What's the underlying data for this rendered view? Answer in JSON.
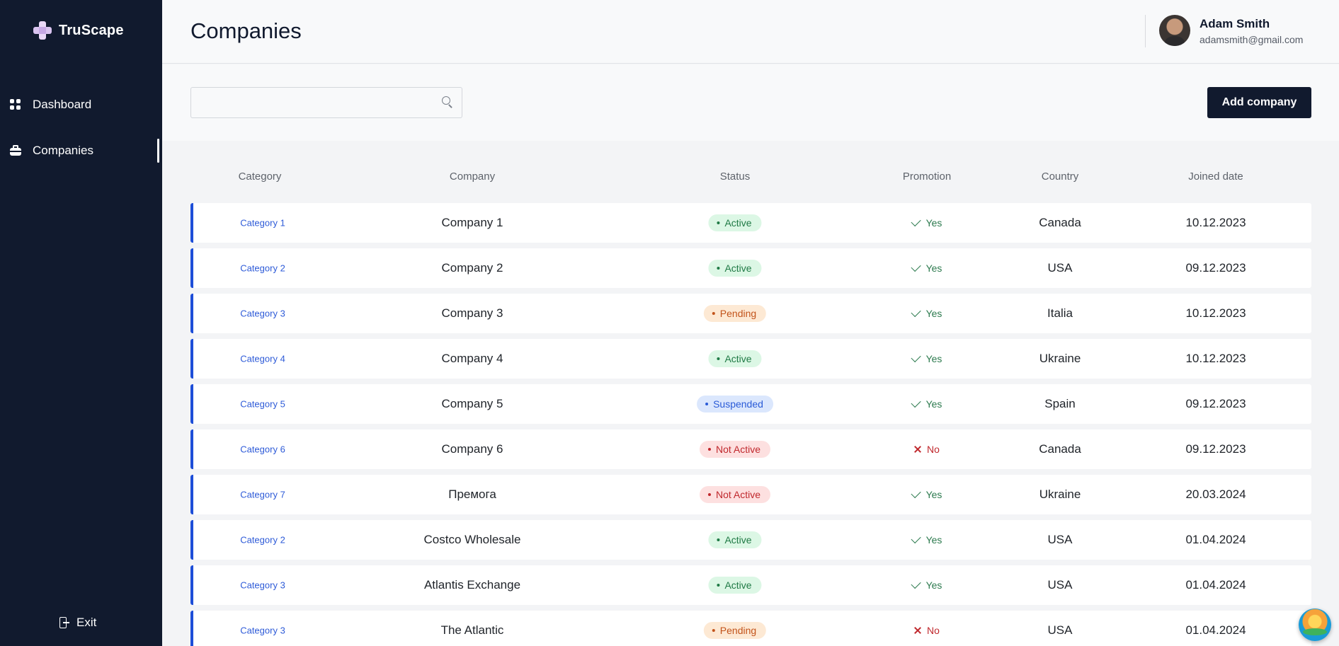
{
  "app": {
    "name": "TruScape"
  },
  "sidebar": {
    "items": [
      {
        "label": "Dashboard",
        "icon": "grid-icon",
        "active": false
      },
      {
        "label": "Companies",
        "icon": "briefcase-icon",
        "active": true
      }
    ],
    "exit_label": "Exit"
  },
  "header": {
    "title": "Companies",
    "user": {
      "name": "Adam Smith",
      "email": "adamsmith@gmail.com"
    }
  },
  "toolbar": {
    "search_value": "",
    "search_placeholder": "",
    "add_button": "Add company"
  },
  "table": {
    "columns": [
      "Category",
      "Company",
      "Status",
      "Promotion",
      "Country",
      "Joined date"
    ],
    "rows": [
      {
        "category": "Category 1",
        "company": "Company 1",
        "status": "Active",
        "status_type": "active",
        "promotion": "Yes",
        "country": "Canada",
        "joined": "10.12.2023"
      },
      {
        "category": "Category 2",
        "company": "Company 2",
        "status": "Active",
        "status_type": "active",
        "promotion": "Yes",
        "country": "USA",
        "joined": "09.12.2023"
      },
      {
        "category": "Category 3",
        "company": "Company 3",
        "status": "Pending",
        "status_type": "pending",
        "promotion": "Yes",
        "country": "Italia",
        "joined": "10.12.2023"
      },
      {
        "category": "Category 4",
        "company": "Company 4",
        "status": "Active",
        "status_type": "active",
        "promotion": "Yes",
        "country": "Ukraine",
        "joined": "10.12.2023"
      },
      {
        "category": "Category 5",
        "company": "Company 5",
        "status": "Suspended",
        "status_type": "suspended",
        "promotion": "Yes",
        "country": "Spain",
        "joined": "09.12.2023"
      },
      {
        "category": "Category 6",
        "company": "Company 6",
        "status": "Not Active",
        "status_type": "notactive",
        "promotion": "No",
        "country": "Canada",
        "joined": "09.12.2023"
      },
      {
        "category": "Category 7",
        "company": "Премога",
        "status": "Not Active",
        "status_type": "notactive",
        "promotion": "Yes",
        "country": "Ukraine",
        "joined": "20.03.2024"
      },
      {
        "category": "Category 2",
        "company": "Costco Wholesale",
        "status": "Active",
        "status_type": "active",
        "promotion": "Yes",
        "country": "USA",
        "joined": "01.04.2024"
      },
      {
        "category": "Category 3",
        "company": "Atlantis Exchange",
        "status": "Active",
        "status_type": "active",
        "promotion": "Yes",
        "country": "USA",
        "joined": "01.04.2024"
      },
      {
        "category": "Category 3",
        "company": "The Atlantic",
        "status": "Pending",
        "status_type": "pending",
        "promotion": "No",
        "country": "USA",
        "joined": "01.04.2024"
      }
    ]
  },
  "colors": {
    "sidebar_bg": "#111a2e",
    "accent": "#1d4ed8",
    "button_bg": "#111a2e"
  }
}
